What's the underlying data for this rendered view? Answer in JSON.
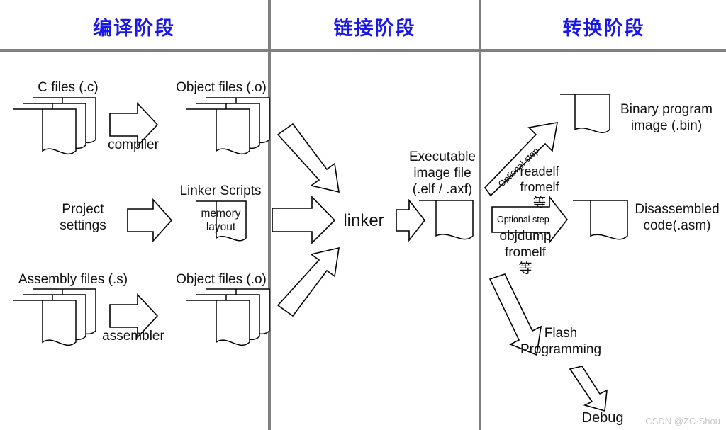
{
  "diagram": {
    "title_columns": [
      {
        "id": "compile",
        "label": "编译阶段"
      },
      {
        "id": "link",
        "label": "链接阶段"
      },
      {
        "id": "convert",
        "label": "转换阶段"
      }
    ],
    "watermark": "CSDN @ZC·Shou"
  },
  "compile_stage": {
    "c_files_label": "C files (.c)",
    "compiler_label": "compiler",
    "object_files_label_top": "Object files (.o)",
    "project_settings_label": "Project\nsettings",
    "linker_scripts_label": "Linker Scripts",
    "memory_layout_label": "memory\nlayout",
    "assembly_files_label": "Assembly files (.s)",
    "assembler_label": "assembler",
    "object_files_label_bottom": "Object files (.o)"
  },
  "link_stage": {
    "linker_label": "linker",
    "executable_label": "Executable\nimage file\n(.elf / .axf)"
  },
  "convert_stage": {
    "optional_step_diagonal": "Optional step",
    "readelf_tools_label": "readelf\nfromelf\n等",
    "binary_image_label": "Binary program\nimage (.bin)",
    "optional_step_horizontal": "Optional step",
    "objdump_tools_label": "objdump\nfromelf\n等",
    "disassembled_label": "Disassembled\ncode(.asm)",
    "flash_programming_label": "Flash\nProgramming",
    "debug_label": "Debug"
  },
  "colors": {
    "header_blue": "#1a18e8",
    "divider_gray": "#808080",
    "stroke_black": "#000000",
    "watermark_gray": "#c9c9c9"
  }
}
